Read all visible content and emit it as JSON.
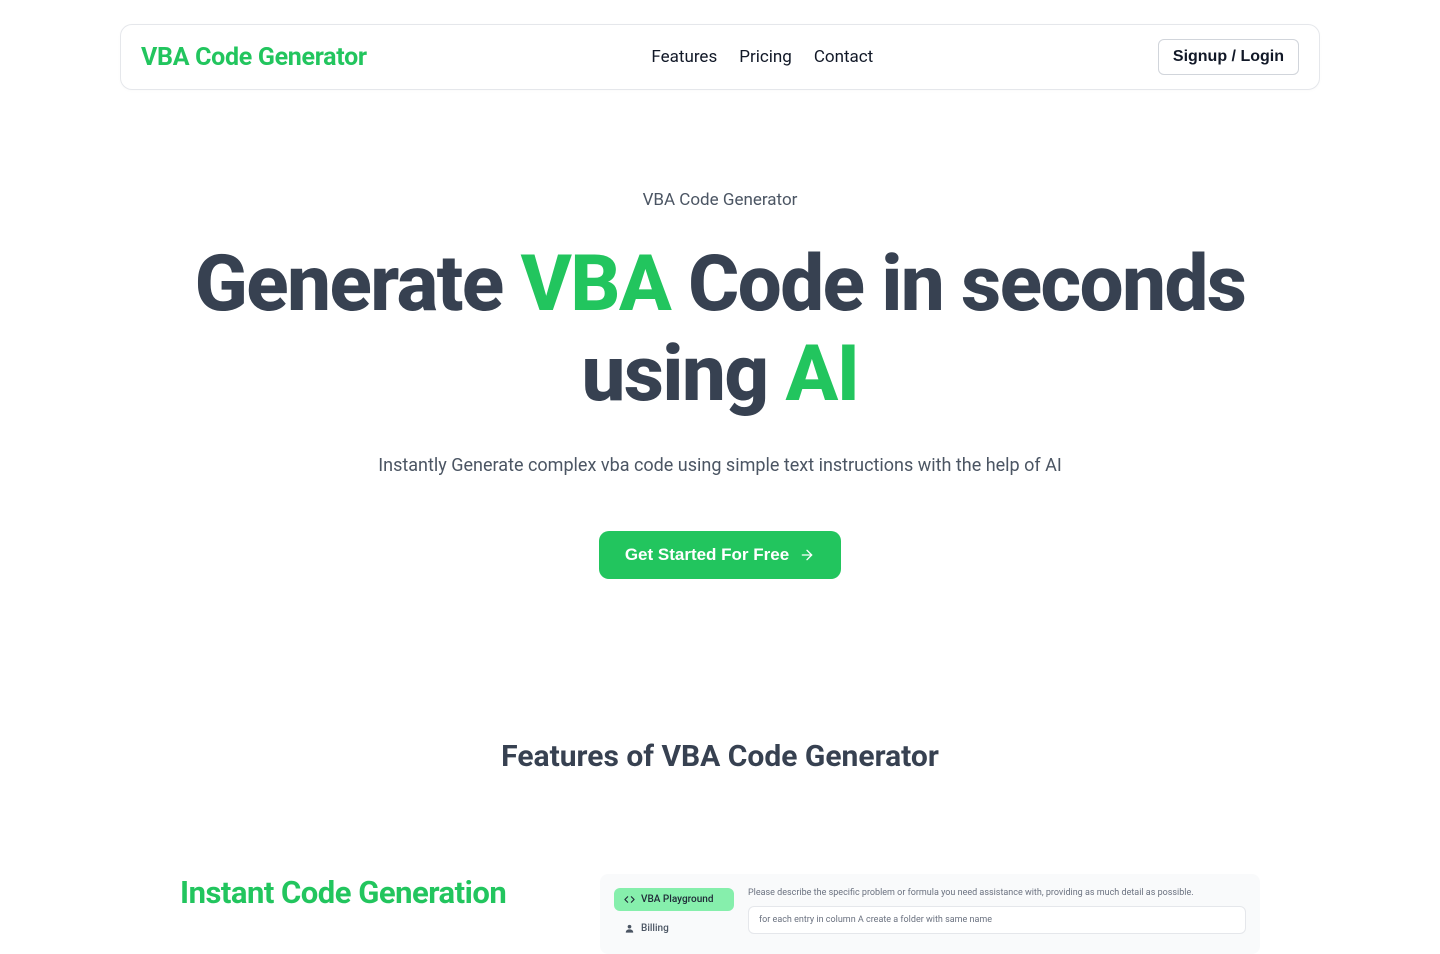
{
  "nav": {
    "logo": "VBA Code Generator",
    "links": [
      "Features",
      "Pricing",
      "Contact"
    ],
    "signup": "Signup / Login"
  },
  "hero": {
    "eyebrow": "VBA Code Generator",
    "title_part1": "Generate ",
    "title_accent1": "VBA",
    "title_part2": " Code in seconds using ",
    "title_accent2": "AI",
    "subtitle": "Instantly Generate complex vba code using simple text instructions with the help of AI",
    "cta": "Get Started For Free"
  },
  "features": {
    "heading": "Features of VBA Code Generator",
    "item1": {
      "title": "Instant Code Generation"
    },
    "preview": {
      "pill_active": "VBA Playground",
      "pill_billing": "Billing",
      "helper": "Please describe the specific problem or formula you need assistance with, providing as much detail as possible.",
      "input_text": "for each entry in column A create a folder with same name"
    }
  }
}
